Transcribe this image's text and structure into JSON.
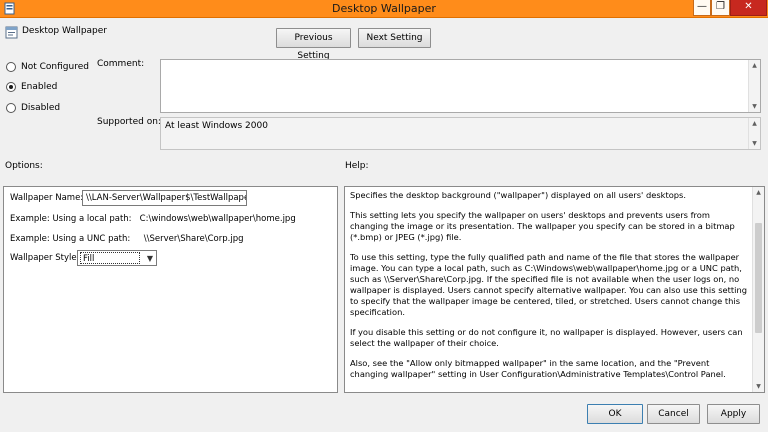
{
  "window": {
    "title": "Desktop Wallpaper",
    "controls": {
      "minimize": "—",
      "restore": "❐",
      "close": "✕"
    }
  },
  "header": {
    "title": "Desktop Wallpaper",
    "previous_label": "Previous Setting",
    "next_label": "Next Setting"
  },
  "state": {
    "options": [
      "Not Configured",
      "Enabled",
      "Disabled"
    ],
    "selected": "Enabled"
  },
  "comment": {
    "label": "Comment:",
    "value": ""
  },
  "supported": {
    "label": "Supported on:",
    "value": "At least Windows 2000"
  },
  "options_section": {
    "label": "Options:",
    "wallpaper_name_label": "Wallpaper Name:",
    "wallpaper_name_value": "\\\\LAN-Server\\Wallpaper$\\TestWallpaper",
    "example_local": "Example: Using a local path:   C:\\windows\\web\\wallpaper\\home.jpg",
    "example_unc": "Example: Using a UNC path:     \\\\Server\\Share\\Corp.jpg",
    "style_label": "Wallpaper Style:",
    "style_value": "Fill"
  },
  "help": {
    "label": "Help:",
    "paragraphs": [
      "Specifies the desktop background (\"wallpaper\") displayed on all users' desktops.",
      "This setting lets you specify the wallpaper on users' desktops and prevents users from changing the image or its presentation. The wallpaper you specify can be stored in a bitmap (*.bmp) or JPEG (*.jpg) file.",
      "To use this setting, type the fully qualified path and name of the file that stores the wallpaper image. You can type a local path, such as C:\\Windows\\web\\wallpaper\\home.jpg or a UNC path, such as \\\\Server\\Share\\Corp.jpg. If the specified file is not available when the user logs on, no wallpaper is displayed. Users cannot specify alternative wallpaper. You can also use this setting to specify that the wallpaper image be centered, tiled, or stretched. Users cannot change this specification.",
      "If you disable this setting or do not configure it, no wallpaper is displayed. However, users can select the wallpaper of their choice.",
      "Also, see the \"Allow only bitmapped wallpaper\" in the same location, and the \"Prevent changing wallpaper\" setting in User Configuration\\Administrative Templates\\Control Panel."
    ]
  },
  "footer": {
    "ok_label": "OK",
    "cancel_label": "Cancel",
    "apply_label": "Apply"
  },
  "colors": {
    "titlebar": "#ff8c1a",
    "close_button": "#c7281f"
  },
  "icons": [
    "policy-app-icon",
    "policy-setting-icon",
    "minimize-icon",
    "restore-icon",
    "close-icon",
    "chevron-up-icon",
    "chevron-down-icon"
  ]
}
